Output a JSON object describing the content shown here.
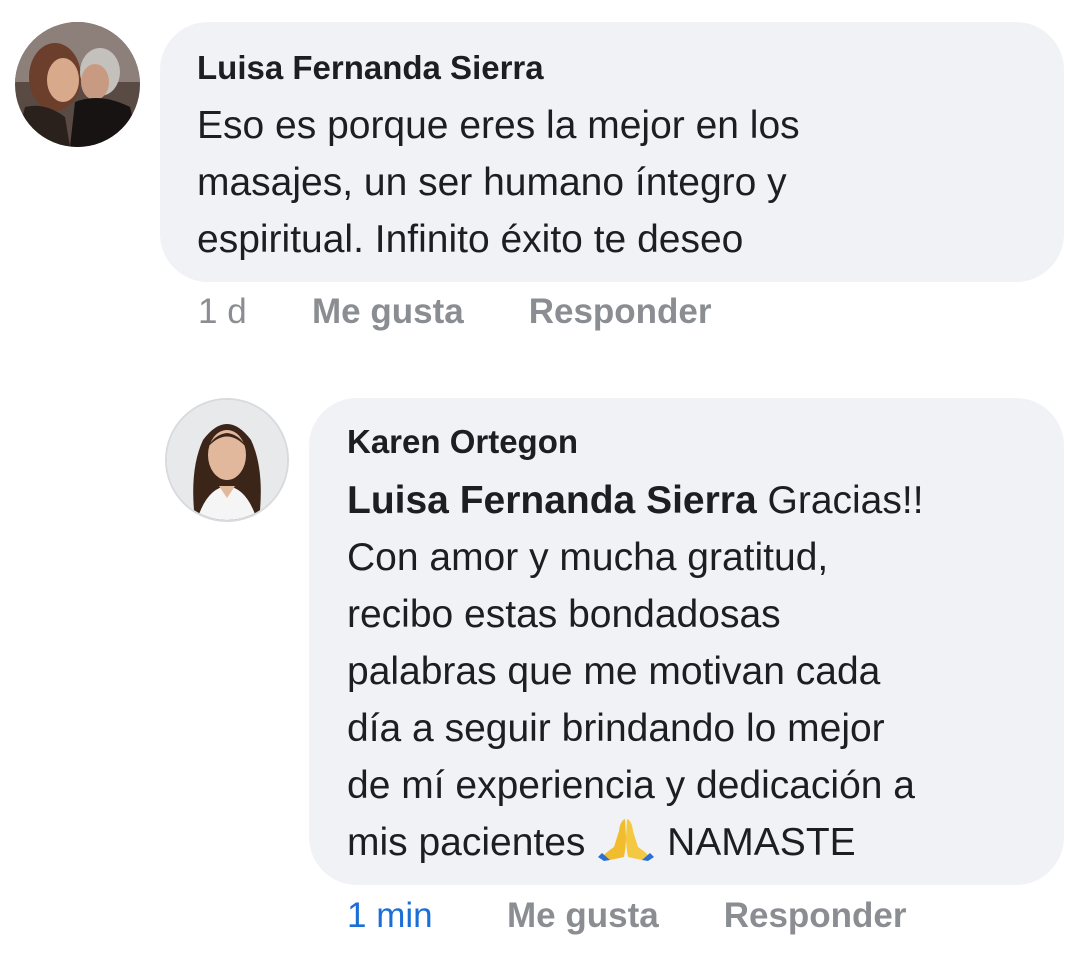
{
  "comments": [
    {
      "author": "Luisa Fernanda Sierra",
      "text": "Eso es porque eres la mejor en los masajes, un ser humano íntegro y espiritual. Infinito éxito te deseo",
      "lines": [
        "Eso es porque eres la mejor en los",
        "masajes, un ser humano íntegro y",
        "espiritual. Infinito éxito te deseo"
      ],
      "time": "1 d",
      "like_label": "Me gusta",
      "reply_label": "Responder"
    },
    {
      "author": "Karen Ortegon",
      "mention": "Luisa Fernanda Sierra",
      "first_line_rest": "Gracias!!",
      "lines": [
        "Con amor y mucha gratitud,",
        "recibo estas bondadosas",
        "palabras que me motivan cada",
        "día a seguir brindando lo mejor",
        "de mí experiencia y dedicación a"
      ],
      "last_line_start": "mis pacientes",
      "emoji": "folded-hands-icon",
      "last_line_end": "NAMASTE",
      "time": "1 min",
      "like_label": "Me gusta",
      "reply_label": "Responder"
    }
  ],
  "colors": {
    "bubble": "#f0f2f5",
    "text": "#1c1e21",
    "muted": "#8a8d91",
    "time_recent": "#1a6ed8"
  }
}
